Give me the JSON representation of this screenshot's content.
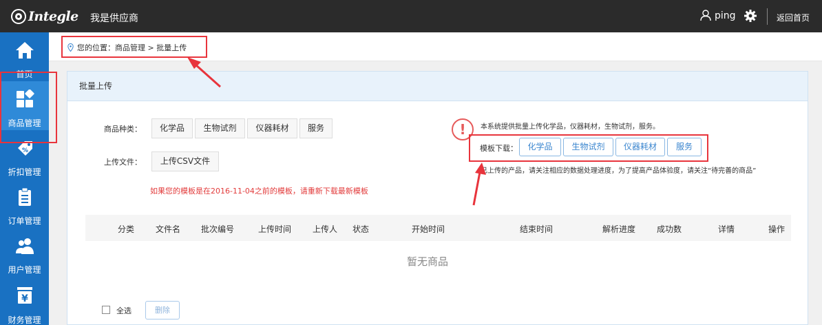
{
  "topbar": {
    "logo_text": "Integle",
    "app_title": "我是供应商",
    "username": "ping",
    "back_home": "返回首页"
  },
  "sidebar": {
    "items": [
      {
        "label": "首页",
        "icon": "home-icon"
      },
      {
        "label": "商品管理",
        "icon": "grid-icon",
        "active": true
      },
      {
        "label": "折扣管理",
        "icon": "discount-icon"
      },
      {
        "label": "订单管理",
        "icon": "clipboard-icon"
      },
      {
        "label": "用户管理",
        "icon": "users-icon"
      },
      {
        "label": "财务管理",
        "icon": "yen-icon"
      }
    ]
  },
  "breadcrumb": "您的位置：商品管理 > 批量上传",
  "panel": {
    "title": "批量上传",
    "category_label": "商品种类：",
    "categories": [
      "化学品",
      "生物试剂",
      "仪器耗材",
      "服务"
    ],
    "upload_label": "上传文件：",
    "upload_button": "上传CSV文件",
    "warning": "如果您的模板是在2016-11-04之前的模板，请重新下载最新模板",
    "notice_line1": "本系统提供批量上传化学品，仪器耗材，生物试剂，服务。",
    "template_label": "模板下载：",
    "templates": [
      "化学品",
      "生物试剂",
      "仪器耗材",
      "服务"
    ],
    "notice_line2": "已上传的产品，请关注相应的数据处理进度，为了提高产品体验度，请关注“待完善的商品”"
  },
  "table": {
    "columns": [
      "分类",
      "文件名",
      "批次编号",
      "上传时间",
      "上传人",
      "状态",
      "开始时间",
      "结束时间",
      "解析进度",
      "成功数",
      "详情",
      "操作"
    ],
    "empty_text": "暂无商品"
  },
  "footer": {
    "select_all": "全选",
    "delete_button": "删除"
  },
  "colors": {
    "topbar": "#2b2b2b",
    "sidebar": "#1971c2",
    "sidebar_active": "#2f8ad8",
    "annotation_red": "#e8343c",
    "link_blue": "#3b86cf"
  }
}
